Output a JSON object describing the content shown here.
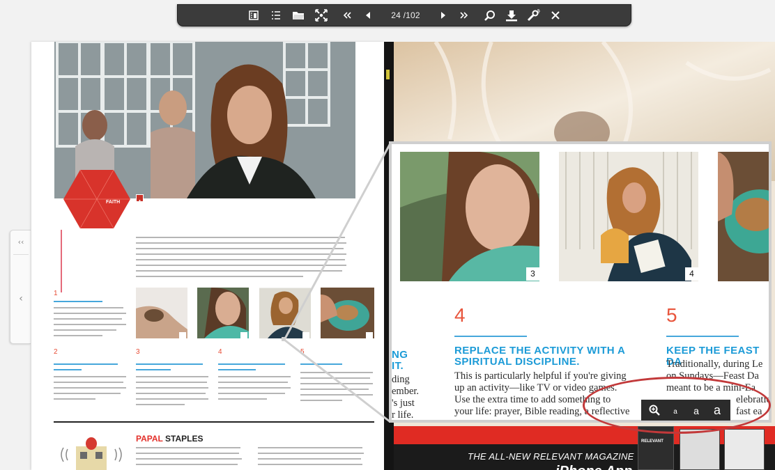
{
  "toolbar": {
    "page_counter": "24 /102",
    "icons": [
      "table-of-contents-icon",
      "list-icon",
      "folder-icon",
      "fullscreen-icon",
      "first-page-icon",
      "previous-page-icon",
      "next-page-icon",
      "last-page-icon",
      "search-icon",
      "download-icon",
      "tools-icon",
      "close-icon"
    ]
  },
  "side_nav": {
    "first_label": "‹‹",
    "prev_label": "‹"
  },
  "left_page": {
    "badge_label": "FAITH",
    "section_numbers": [
      "1",
      "2",
      "3",
      "4",
      "5"
    ],
    "papal_prefix": "PAPAL",
    "papal_suffix": " STAPLES"
  },
  "zoom": {
    "badges": [
      "3",
      "4"
    ],
    "partial_heading": "NG IT.",
    "partial_body": [
      "ding",
      "ember.",
      "'s just",
      "r life."
    ],
    "col4": {
      "number": "4",
      "heading_line1": "REPLACE THE ACTIVITY WITH A",
      "heading_line2": "SPIRITUAL DISCIPLINE.",
      "body": [
        "This is particularly helpful if you're giving",
        "up an activity—like TV or video games.",
        "Use the extra time to add something to",
        "your life: prayer, Bible reading, a reflective"
      ]
    },
    "col5": {
      "number": "5",
      "heading": "KEEP THE FEAST DA",
      "body": [
        "Traditionally, during Le",
        "on Sundays—Feast Da",
        "meant to be a mini-Ea",
        "elebration. So k",
        "fast ea"
      ]
    }
  },
  "font_controls": {
    "zoom_icon": "zoom-in-icon",
    "small": "a",
    "medium": "a",
    "large": "a"
  },
  "promo": {
    "line": "THE ALL-NEW RELEVANT MAGAZINE",
    "big": "iPhone App",
    "badge_label": "RELEVANT"
  },
  "colors": {
    "accent_blue": "#1c9bd7",
    "accent_red": "#e3302a",
    "toolbar_bg": "#3b3b3b",
    "highlight": "#c2393a"
  }
}
